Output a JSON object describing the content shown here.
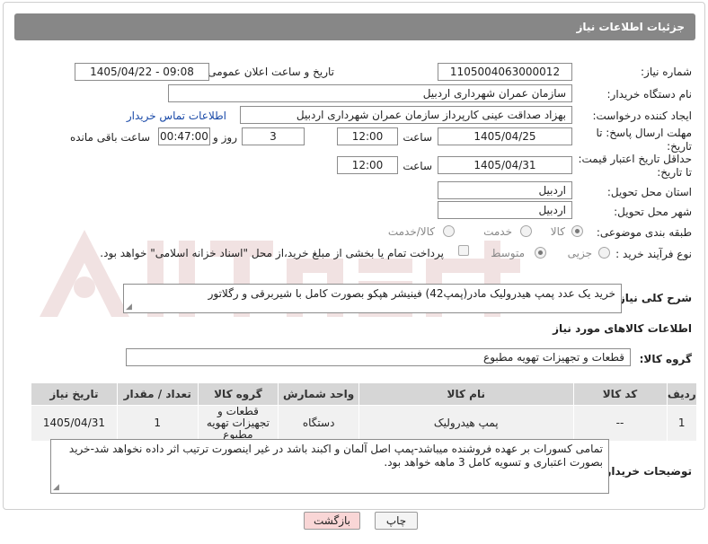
{
  "header": {
    "title": "جزئیات اطلاعات نیاز"
  },
  "fields": {
    "need_number_label": "شماره نیاز:",
    "need_number": "1105004063000012",
    "announce_label": "تاریخ و ساعت اعلان عمومی:",
    "announce_value": "1405/04/22 - 09:08",
    "buyer_org_label": "نام دستگاه خریدار:",
    "buyer_org": "سازمان عمران شهرداری اردبیل",
    "creator_label": "ایجاد کننده درخواست:",
    "creator": "بهزاد  صداقت عینی کارپرداز سازمان عمران شهرداری اردبیل",
    "contact_link": "اطلاعات تماس خریدار",
    "deadline_label_1": "مهلت ارسال پاسخ: تا",
    "deadline_label_2": "تاریخ:",
    "deadline_date": "1405/04/25",
    "time_word": "ساعت",
    "deadline_time": "12:00",
    "days_value": "3",
    "days_word": "روز و",
    "remaining_time": "00:47:00",
    "remaining_word": "ساعت باقی مانده",
    "price_validity_label_1": "حداقل تاریخ اعتبار قیمت:",
    "price_validity_label_2": "تا تاریخ:",
    "price_validity_date": "1405/04/31",
    "price_validity_time": "12:00",
    "province_label": "استان محل تحویل:",
    "province": "اردبیل",
    "city_label": "شهر محل تحویل:",
    "city": "اردبیل",
    "category_label": "طبقه بندی موضوعی:",
    "category_options": [
      "کالا",
      "خدمت",
      "کالا/خدمت"
    ],
    "purchase_type_label": "نوع فرآیند خرید :",
    "purchase_options": [
      "جزیی",
      "متوسط"
    ],
    "payment_note": "پرداخت تمام یا بخشی از مبلغ خرید،از محل \"اسناد خزانه اسلامی\" خواهد بود."
  },
  "description": {
    "label": "شرح کلی نیاز:",
    "text": "خرید یک عدد پمپ هیدرولیک مادر(پمپ42) فینیشر هپکو بصورت کامل با شیربرقی و رگلاتور"
  },
  "goods_info": {
    "title": "اطلاعات کالاهای مورد نیاز",
    "group_label": "گروه کالا:",
    "group_value": "قطعات و تجهیزات تهویه مطبوع"
  },
  "table": {
    "headers": [
      "ردیف",
      "کد کالا",
      "نام کالا",
      "واحد شمارش",
      "گروه کالا",
      "تعداد / مقدار",
      "تاریخ نیاز"
    ],
    "rows": [
      [
        "1",
        "--",
        "پمپ هیدرولیک",
        "دستگاه",
        "قطعات و تجهیزات تهویه مطبوع",
        "1",
        "1405/04/31"
      ]
    ]
  },
  "buyer_notes": {
    "label": "توضیحات خریدار:",
    "text": "تمامی کسورات بر عهده فروشنده میباشد-پمپ اصل آلمان و اکبند باشد در غیر اینصورت ترتیب اثر داده نخواهد شد-خرید بصورت اعتباری و تسویه کامل 3 ماهه خواهد بود."
  },
  "buttons": {
    "print": "چاپ",
    "back": "بازگشت"
  },
  "colors": {
    "header_bg": "#878787",
    "back_button_bg": "#f9d6d6",
    "link": "#1a4aa8"
  }
}
